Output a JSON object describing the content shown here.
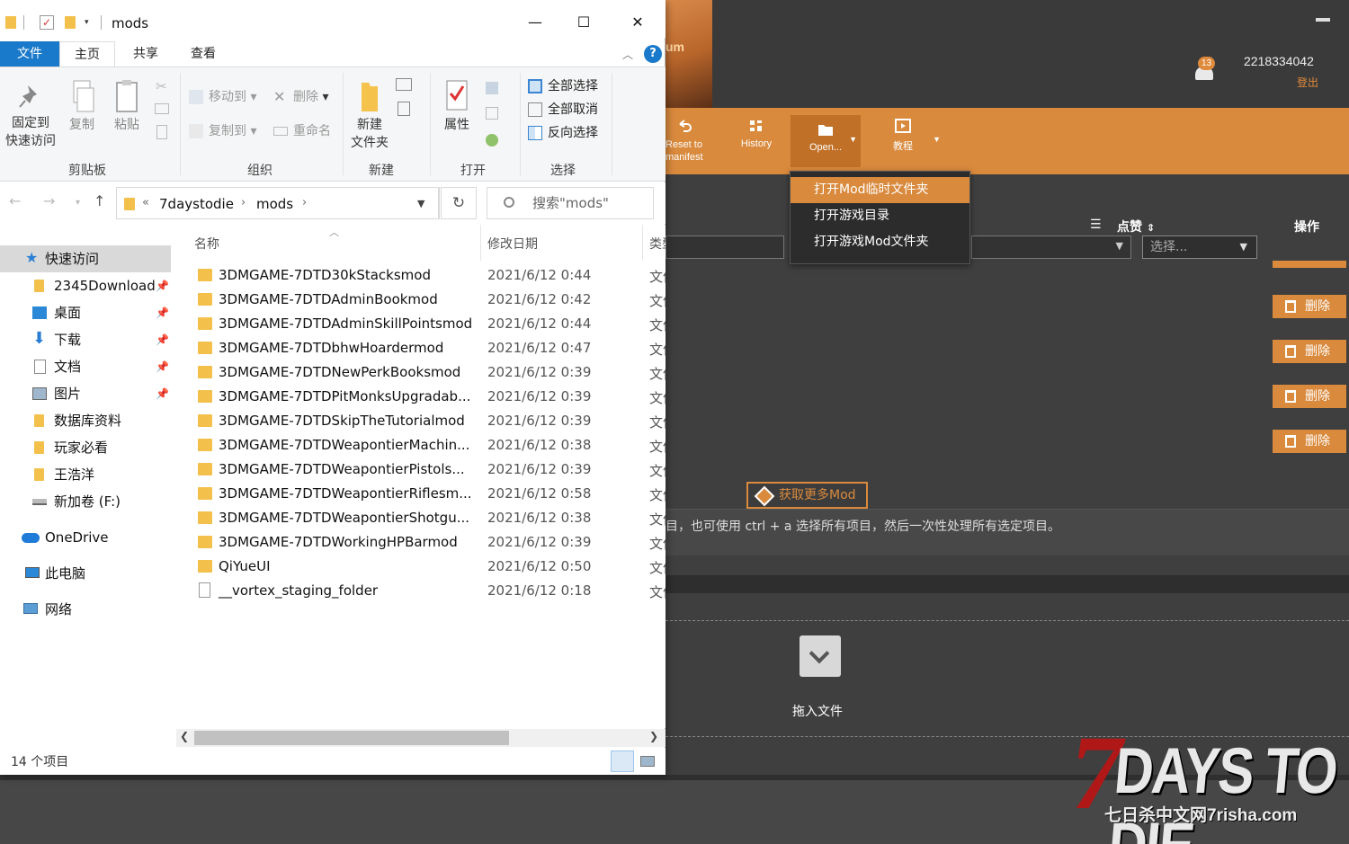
{
  "explorer": {
    "title": "mods",
    "window_buttons": {
      "minimize": "—",
      "maximize": "☐",
      "close": "✕"
    },
    "ribbon_tabs": [
      "文件",
      "主页",
      "共享",
      "查看"
    ],
    "ribbon_collapse": "︿",
    "help": "?",
    "ribbon": {
      "clipboard": {
        "pin": "固定到\n快速访问",
        "copy": "复制",
        "paste": "粘贴",
        "label": "剪贴板"
      },
      "organize": {
        "move_to": "移动到",
        "copy_to": "复制到",
        "delete": "删除",
        "rename": "重命名",
        "label": "组织"
      },
      "new": {
        "new_folder": "新建\n文件夹",
        "label": "新建"
      },
      "open": {
        "properties": "属性",
        "label": "打开"
      },
      "select": {
        "select_all": "全部选择",
        "select_none": "全部取消",
        "invert": "反向选择",
        "label": "选择"
      }
    },
    "address": {
      "prefix": "«",
      "crumbs": [
        "7daystodie",
        "mods"
      ],
      "sep": "›",
      "refresh": "↻",
      "search_placeholder": "搜索\"mods\""
    },
    "nav": {
      "quick_access": "快速访问",
      "items": [
        {
          "label": "2345Download",
          "pinned": true
        },
        {
          "label": "桌面",
          "pinned": true
        },
        {
          "label": "下载",
          "pinned": true
        },
        {
          "label": "文档",
          "pinned": true
        },
        {
          "label": "图片",
          "pinned": true
        },
        {
          "label": "数据库资料",
          "pinned": false
        },
        {
          "label": "玩家必看",
          "pinned": false
        },
        {
          "label": "王浩洋",
          "pinned": false
        },
        {
          "label": "新加卷 (F:)",
          "pinned": false
        }
      ],
      "onedrive": "OneDrive",
      "this_pc": "此电脑",
      "network": "网络"
    },
    "columns": {
      "name": "名称",
      "modified": "修改日期",
      "type": "类型"
    },
    "files": [
      {
        "name": "3DMGAME-7DTD30kStacksmod",
        "date": "2021/6/12 0:44",
        "type": "文件夹",
        "kind": "folder"
      },
      {
        "name": "3DMGAME-7DTDAdminBookmod",
        "date": "2021/6/12 0:42",
        "type": "文件夹",
        "kind": "folder"
      },
      {
        "name": "3DMGAME-7DTDAdminSkillPointsmod",
        "date": "2021/6/12 0:44",
        "type": "文件夹",
        "kind": "folder"
      },
      {
        "name": "3DMGAME-7DTDbhwHoardermod",
        "date": "2021/6/12 0:47",
        "type": "文件夹",
        "kind": "folder"
      },
      {
        "name": "3DMGAME-7DTDNewPerkBooksmod",
        "date": "2021/6/12 0:39",
        "type": "文件夹",
        "kind": "folder"
      },
      {
        "name": "3DMGAME-7DTDPitMonksUpgradab...",
        "date": "2021/6/12 0:39",
        "type": "文件夹",
        "kind": "folder"
      },
      {
        "name": "3DMGAME-7DTDSkipTheTutorialmod",
        "date": "2021/6/12 0:39",
        "type": "文件夹",
        "kind": "folder"
      },
      {
        "name": "3DMGAME-7DTDWeapontierMachin...",
        "date": "2021/6/12 0:38",
        "type": "文件夹",
        "kind": "folder"
      },
      {
        "name": "3DMGAME-7DTDWeapontierPistols...",
        "date": "2021/6/12 0:39",
        "type": "文件夹",
        "kind": "folder"
      },
      {
        "name": "3DMGAME-7DTDWeapontierRiflesm...",
        "date": "2021/6/12 0:58",
        "type": "文件夹",
        "kind": "folder"
      },
      {
        "name": "3DMGAME-7DTDWeapontierShotgu...",
        "date": "2021/6/12 0:38",
        "type": "文件夹",
        "kind": "folder"
      },
      {
        "name": "3DMGAME-7DTDWorkingHPBarmod",
        "date": "2021/6/12 0:39",
        "type": "文件夹",
        "kind": "folder"
      },
      {
        "name": "QiYueUI",
        "date": "2021/6/12 0:50",
        "type": "文件夹",
        "kind": "folder"
      },
      {
        "name": "__vortex_staging_folder",
        "date": "2021/6/12 0:18",
        "type": "文件",
        "kind": "file"
      }
    ],
    "status": "14 个项目"
  },
  "vortex": {
    "banner_text": "um",
    "notification_count": "13",
    "user_id": "2218334042",
    "logout": "登出",
    "toolbar": {
      "reset": "Reset to\nmanifest",
      "history": "History",
      "open": "Open...",
      "tutorial": "教程"
    },
    "open_menu": [
      "打开Mod临时文件夹",
      "打开游戏目录",
      "打开游戏Mod文件夹"
    ],
    "columns": {
      "endorse": "点赞",
      "actions": "操作"
    },
    "select_placeholder": "选择...",
    "delete_label": "删除",
    "more_mods": "获取更多Mod",
    "hint": "目，也可使用 ctrl + a 选择所有项目，然后一次性处理所有选定项目。",
    "drop_label": "拖入文件",
    "logo": {
      "seven": "7",
      "title": "DAYS TO DIE",
      "site": "七日杀中文网7risha.com"
    },
    "colors": {
      "accent": "#d98a3d",
      "dark": "#3f3f3f"
    }
  }
}
